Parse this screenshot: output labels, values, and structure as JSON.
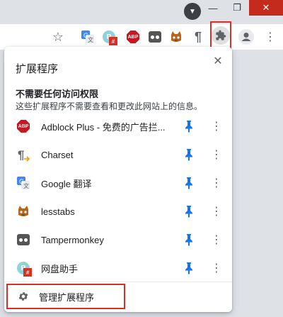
{
  "window": {
    "minimize_glyph": "—",
    "restore_glyph": "❐",
    "close_glyph": "✕",
    "downloads_glyph": "▼"
  },
  "toolbar": {
    "star_glyph": "☆",
    "pilcrow_glyph": "¶",
    "menu_glyph": "⋮"
  },
  "popup": {
    "title": "扩展程序",
    "close_glyph": "✕",
    "section_heading": "不需要任何访问权限",
    "section_description": "这些扩展程序不需要查看和更改此网站上的信息。",
    "extensions": [
      {
        "name": "Adblock Plus - 免费的广告拦...",
        "icon": "abp-icon"
      },
      {
        "name": "Charset",
        "icon": "charset-icon"
      },
      {
        "name": "Google 翻译",
        "icon": "google-translate-icon"
      },
      {
        "name": "lesstabs",
        "icon": "lesstabs-icon"
      },
      {
        "name": "Tampermonkey",
        "icon": "tampermonkey-icon"
      },
      {
        "name": "网盘助手",
        "icon": "netdisk-icon"
      }
    ],
    "menu_glyph": "⋮",
    "manage_label": "管理扩展程序"
  },
  "colors": {
    "pin": "#1a73e8",
    "highlight": "#d93025",
    "abp": "#c71720"
  }
}
